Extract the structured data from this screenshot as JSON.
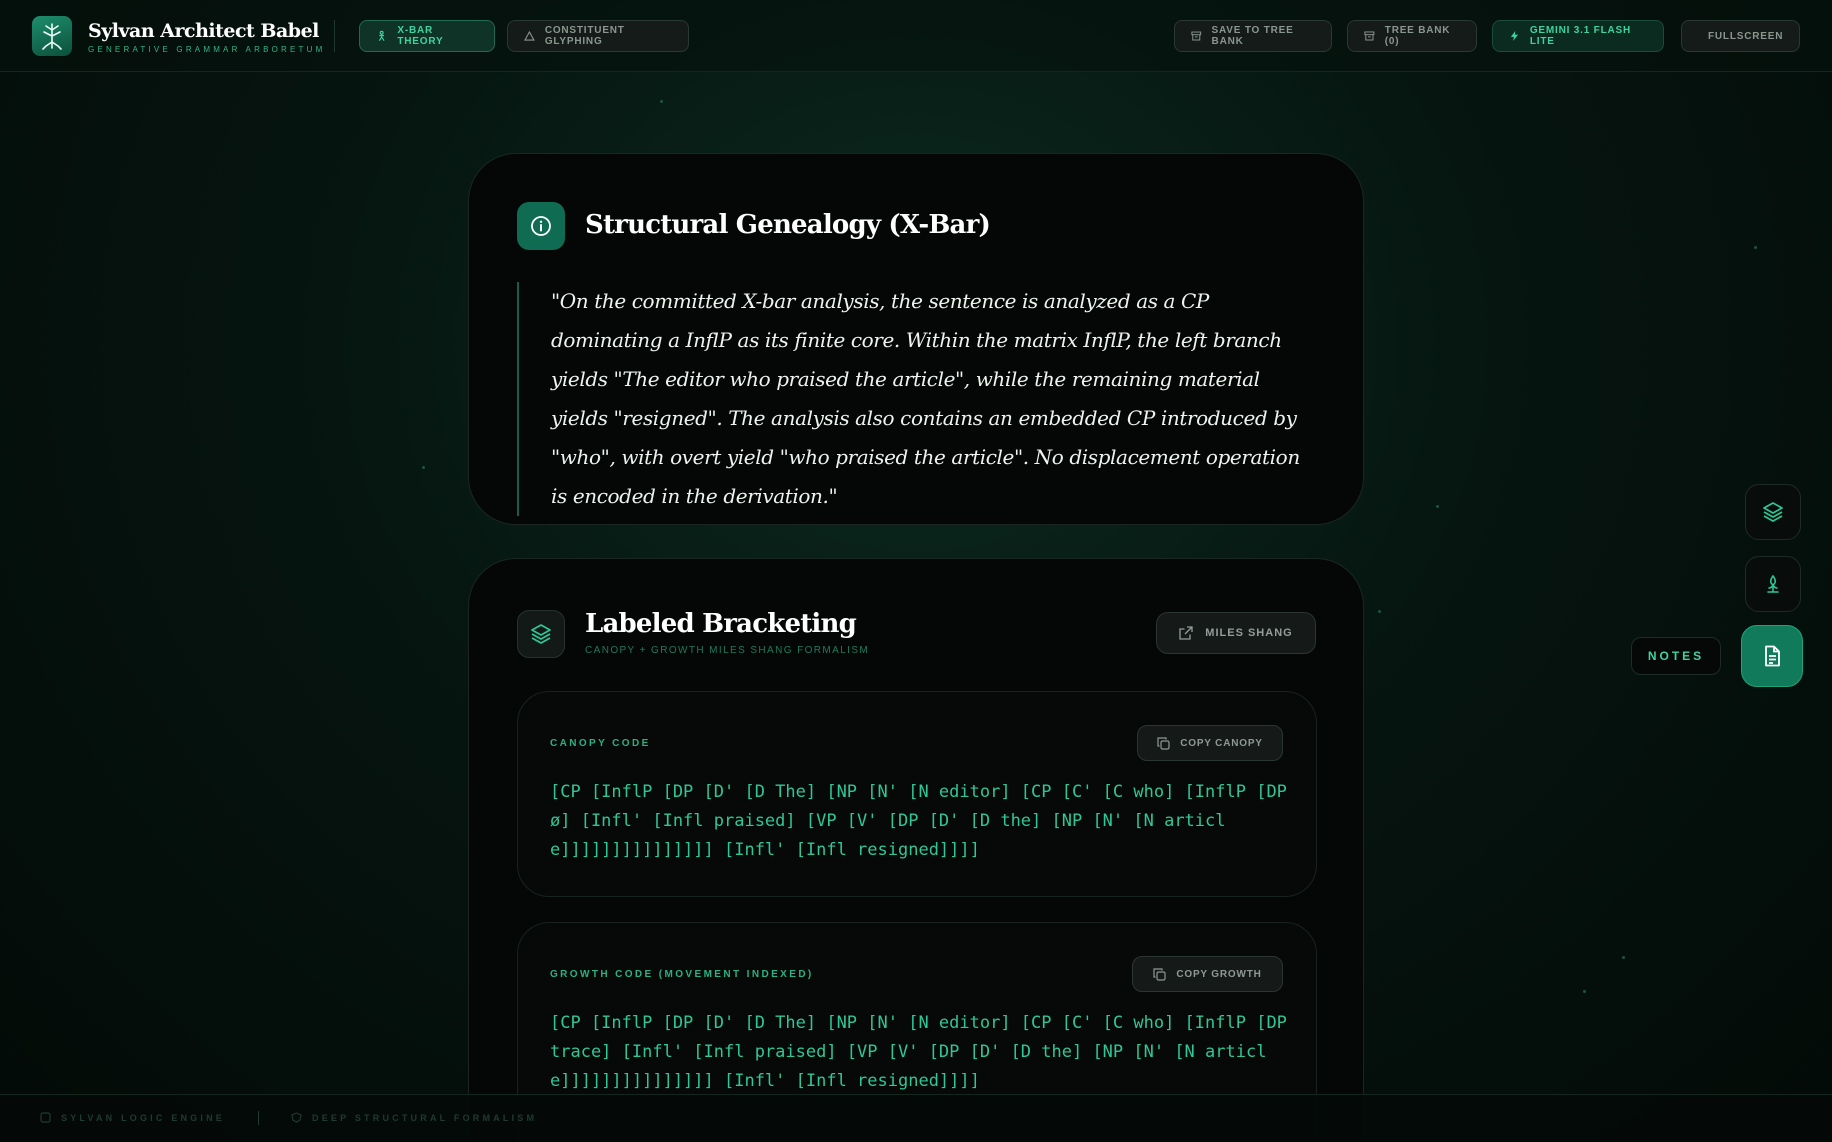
{
  "app": {
    "title": "Sylvan Architect Babel",
    "subtitle": "GENERATIVE GRAMMAR ARBORETUM"
  },
  "header": {
    "modes": [
      {
        "label": "X-BAR THEORY",
        "icon": "person-icon",
        "active": true
      },
      {
        "label": "CONSTITUENT GLYPHING",
        "icon": "triangle-icon",
        "active": false
      }
    ],
    "actions": [
      {
        "label": "SAVE TO TREE BANK",
        "icon": "archive-icon"
      },
      {
        "label": "TREE BANK (0)",
        "icon": "archive-icon"
      },
      {
        "label": "GEMINI 3.1 FLASH LITE",
        "icon": "bolt-icon"
      },
      {
        "label": "FULLSCREEN",
        "icon": "expand-icon"
      }
    ]
  },
  "genealogy": {
    "title": "Structural Genealogy (X-Bar)",
    "icon": "info-icon",
    "quote": "\"On the committed X-bar analysis, the sentence is analyzed as a CP dominating a InflP as its finite core. Within the matrix InflP, the left branch yields \"The editor who praised the article\", while the remaining material yields \"resigned\". The analysis also contains an embedded CP introduced by \"who\", with overt yield \"who praised the article\". No displacement operation is encoded in the derivation.\""
  },
  "bracketing": {
    "title": "Labeled Bracketing",
    "subtitle": "CANOPY + GROWTH MILES SHANG FORMALISM",
    "icon": "layers-icon",
    "external_label": "MILES SHANG",
    "canopy": {
      "label": "CANOPY CODE",
      "copy_label": "COPY CANOPY",
      "code": "[CP [InflP [DP [D' [D The] [NP [N' [N editor] [CP [C' [C who] [InflP [DP ø] [Infl' [Infl praised] [VP [V' [DP [D' [D the] [NP [N' [N article]]]]]]]]]]]]]]] [Infl' [Infl resigned]]]]"
    },
    "growth": {
      "label": "GROWTH CODE (MOVEMENT INDEXED)",
      "copy_label": "COPY GROWTH",
      "code": "[CP [InflP [DP [D' [D The] [NP [N' [N editor] [CP [C' [C who] [InflP [DP trace] [Infl' [Infl praised] [VP [V' [DP [D' [D the] [NP [N' [N article]]]]]]]]]]]]]]] [Infl' [Infl resigned]]]]"
    }
  },
  "rail": {
    "notes_label": "NOTES",
    "buttons": [
      "layers-icon",
      "tree-icon",
      "document-icon"
    ]
  },
  "footer": {
    "left1": "SYLVAN LOGIC ENGINE",
    "left2": "DEEP STRUCTURAL FORMALISM"
  },
  "colors": {
    "accent": "#2ec797",
    "accent_dark": "#0f6b51",
    "background": "#061510"
  }
}
